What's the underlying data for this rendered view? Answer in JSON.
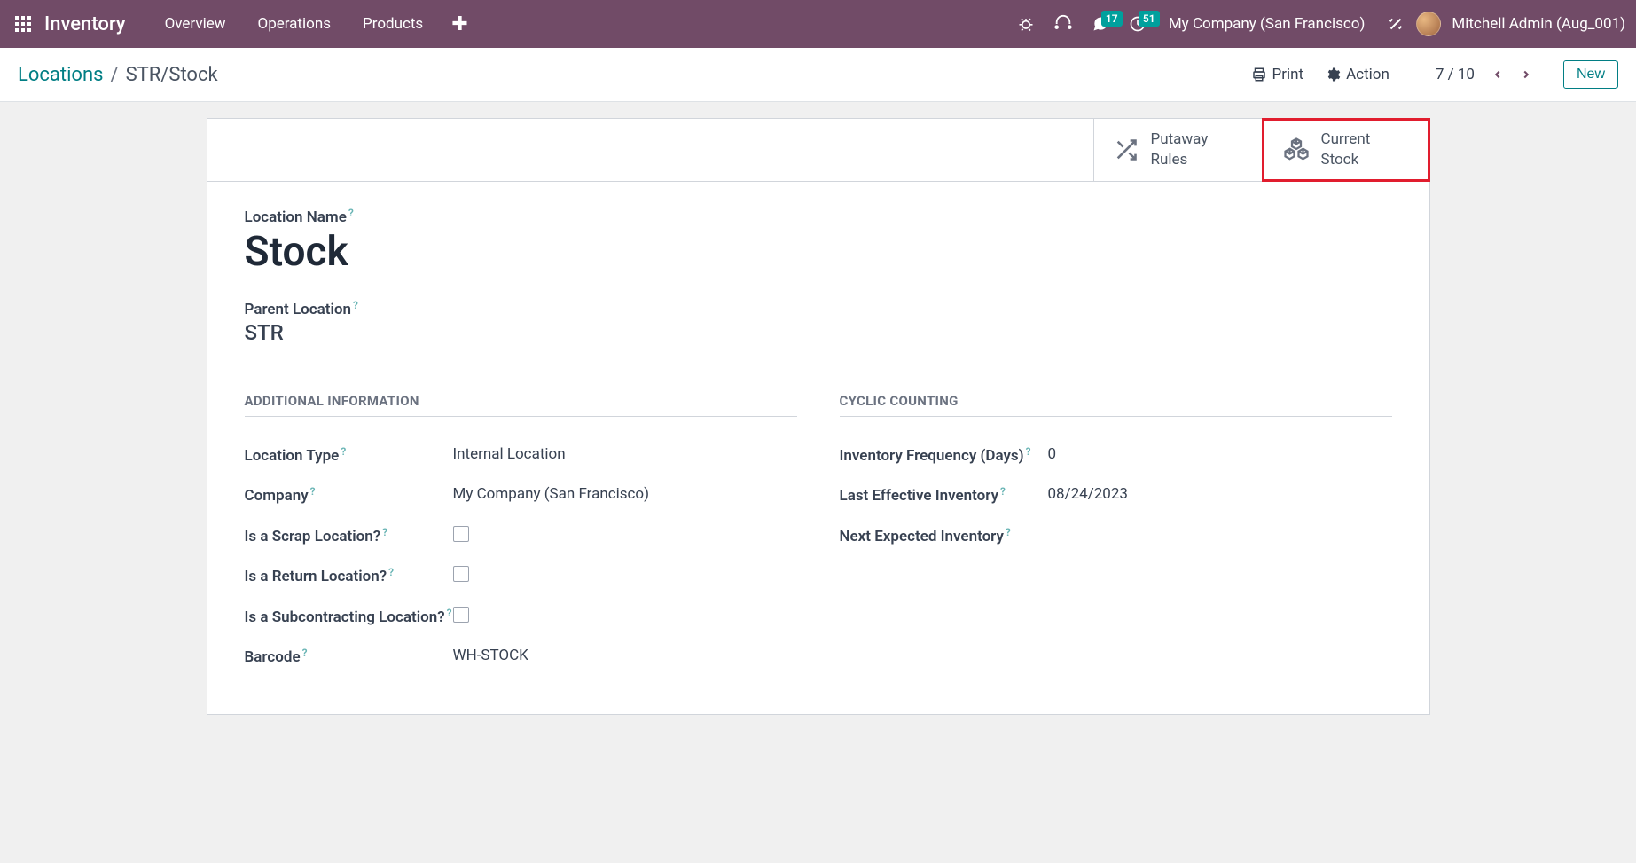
{
  "topbar": {
    "brand": "Inventory",
    "nav": [
      "Overview",
      "Operations",
      "Products"
    ],
    "messages_count": "17",
    "activities_count": "51",
    "company": "My Company (San Francisco)",
    "username": "Mitchell Admin (Aug_001)"
  },
  "breadcrumb": {
    "parent": "Locations",
    "current": "STR/Stock"
  },
  "control": {
    "print": "Print",
    "action": "Action",
    "pager": "7 / 10",
    "new": "New"
  },
  "stat_buttons": {
    "putaway": "Putaway\nRules",
    "current_stock": "Current\nStock"
  },
  "form": {
    "location_name_label": "Location Name",
    "location_name_value": "Stock",
    "parent_location_label": "Parent Location",
    "parent_location_value": "STR",
    "section_additional": "ADDITIONAL INFORMATION",
    "section_cyclic": "CYCLIC COUNTING",
    "fields": {
      "location_type_label": "Location Type",
      "location_type_value": "Internal Location",
      "company_label": "Company",
      "company_value": "My Company (San Francisco)",
      "is_scrap_label": "Is a Scrap Location?",
      "is_return_label": "Is a Return Location?",
      "is_subcon_label": "Is a Subcontracting Location?",
      "barcode_label": "Barcode",
      "barcode_value": "WH-STOCK",
      "inv_freq_label": "Inventory Frequency (Days)",
      "inv_freq_value": "0",
      "last_eff_label": "Last Effective Inventory",
      "last_eff_value": "08/24/2023",
      "next_exp_label": "Next Expected Inventory",
      "next_exp_value": ""
    }
  }
}
